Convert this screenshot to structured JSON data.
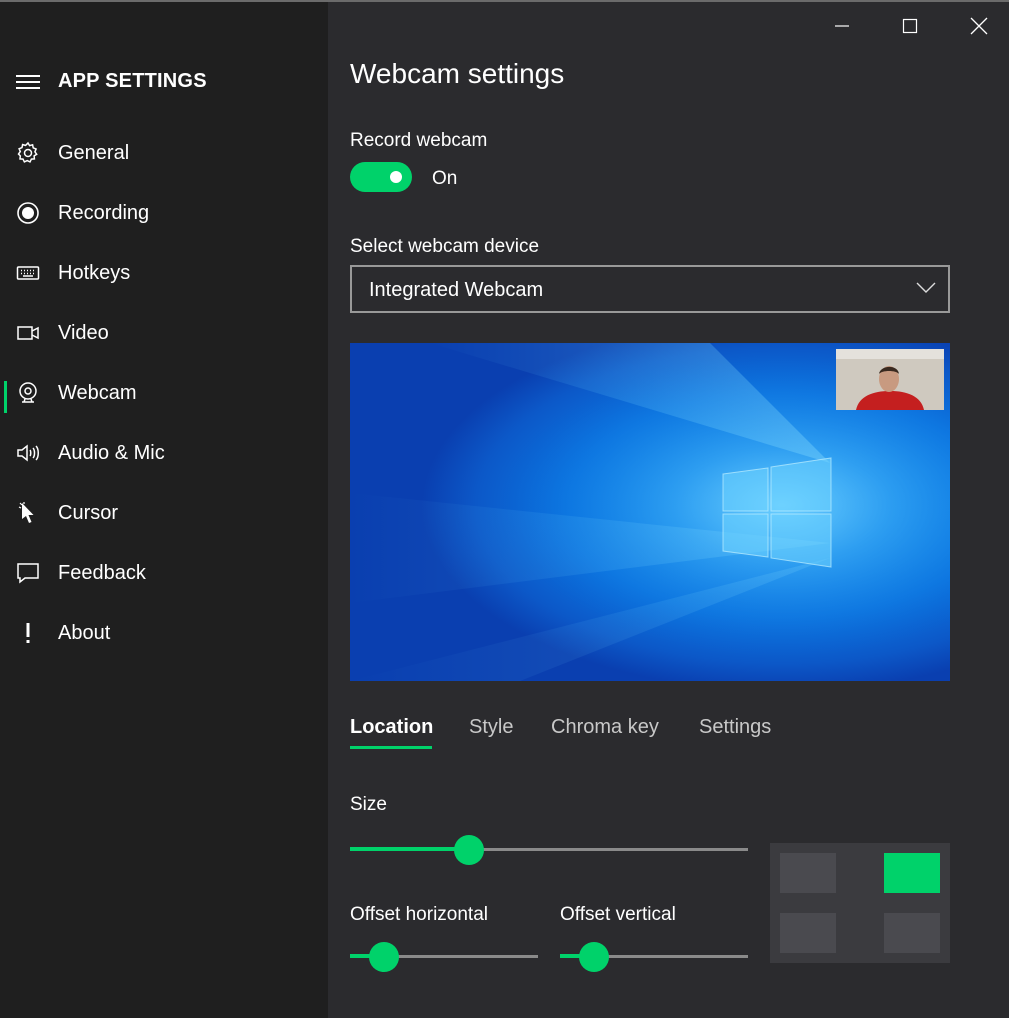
{
  "sidebar": {
    "app_title": "APP SETTINGS",
    "items": [
      {
        "label": "General",
        "icon": "gear-icon"
      },
      {
        "label": "Recording",
        "icon": "record-icon"
      },
      {
        "label": "Hotkeys",
        "icon": "keyboard-icon"
      },
      {
        "label": "Video",
        "icon": "video-camera-icon"
      },
      {
        "label": "Webcam",
        "icon": "webcam-icon",
        "active": true
      },
      {
        "label": "Audio & Mic",
        "icon": "speaker-icon"
      },
      {
        "label": "Cursor",
        "icon": "cursor-icon"
      },
      {
        "label": "Feedback",
        "icon": "chat-bubble-icon"
      },
      {
        "label": "About",
        "icon": "exclamation-icon"
      }
    ]
  },
  "main": {
    "title": "Webcam settings",
    "record_label": "Record webcam",
    "toggle_state": "On",
    "device_label": "Select webcam device",
    "device_value": "Integrated Webcam",
    "tabs": [
      {
        "label": "Location",
        "active": true
      },
      {
        "label": "Style"
      },
      {
        "label": "Chroma key"
      },
      {
        "label": "Settings"
      }
    ],
    "size_label": "Size",
    "size_value": 0.3,
    "offset_h_label": "Offset horizontal",
    "offset_h_value": 0.18,
    "offset_v_label": "Offset vertical",
    "offset_v_value": 0.18,
    "position_selected": "top-right"
  },
  "colors": {
    "accent": "#00d26a",
    "sidebar_bg": "#1f1f1f",
    "main_bg": "#2b2b2e"
  }
}
